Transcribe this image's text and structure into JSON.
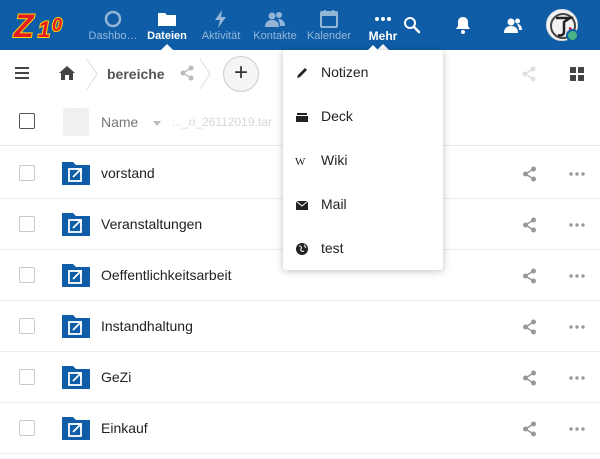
{
  "header": {
    "logo_text": "Z10",
    "apps": [
      {
        "label": "Dashbo…",
        "icon": "dashboard-icon"
      },
      {
        "label": "Dateien",
        "icon": "folder-icon"
      },
      {
        "label": "Aktivität",
        "icon": "lightning-icon"
      },
      {
        "label": "Kontakte",
        "icon": "contacts-icon"
      },
      {
        "label": "Kalender",
        "icon": "calendar-icon"
      },
      {
        "label": "Mehr",
        "icon": "more-horizontal-icon"
      }
    ],
    "active_app": "Dateien",
    "right_icons": [
      "search-icon",
      "notifications-icon",
      "contacts-menu-icon",
      "avatar"
    ],
    "colors": {
      "header_bg": "#0f5da7",
      "status_online": "#49b382"
    }
  },
  "breadcrumb": {
    "home_icon": "home-icon",
    "current": "bereiche",
    "add_label": "+"
  },
  "file_list": {
    "header": {
      "name_label": "Name",
      "ghost_text": "..._ri_26112019.tar"
    },
    "folders": [
      {
        "name": "vorstand"
      },
      {
        "name": "Veranstaltungen"
      },
      {
        "name": "Oeffentlichkeitsarbeit"
      },
      {
        "name": "Instandhaltung"
      },
      {
        "name": "GeZi"
      },
      {
        "name": "Einkauf"
      }
    ],
    "colors": {
      "folder": "#0f5da7"
    }
  },
  "mehr_menu": {
    "items": [
      {
        "label": "Notizen",
        "icon": "pencil-icon"
      },
      {
        "label": "Deck",
        "icon": "deck-icon"
      },
      {
        "label": "Wiki",
        "icon": "wiki-icon"
      },
      {
        "label": "Mail",
        "icon": "mail-icon"
      },
      {
        "label": "test",
        "icon": "globe-icon"
      }
    ]
  }
}
